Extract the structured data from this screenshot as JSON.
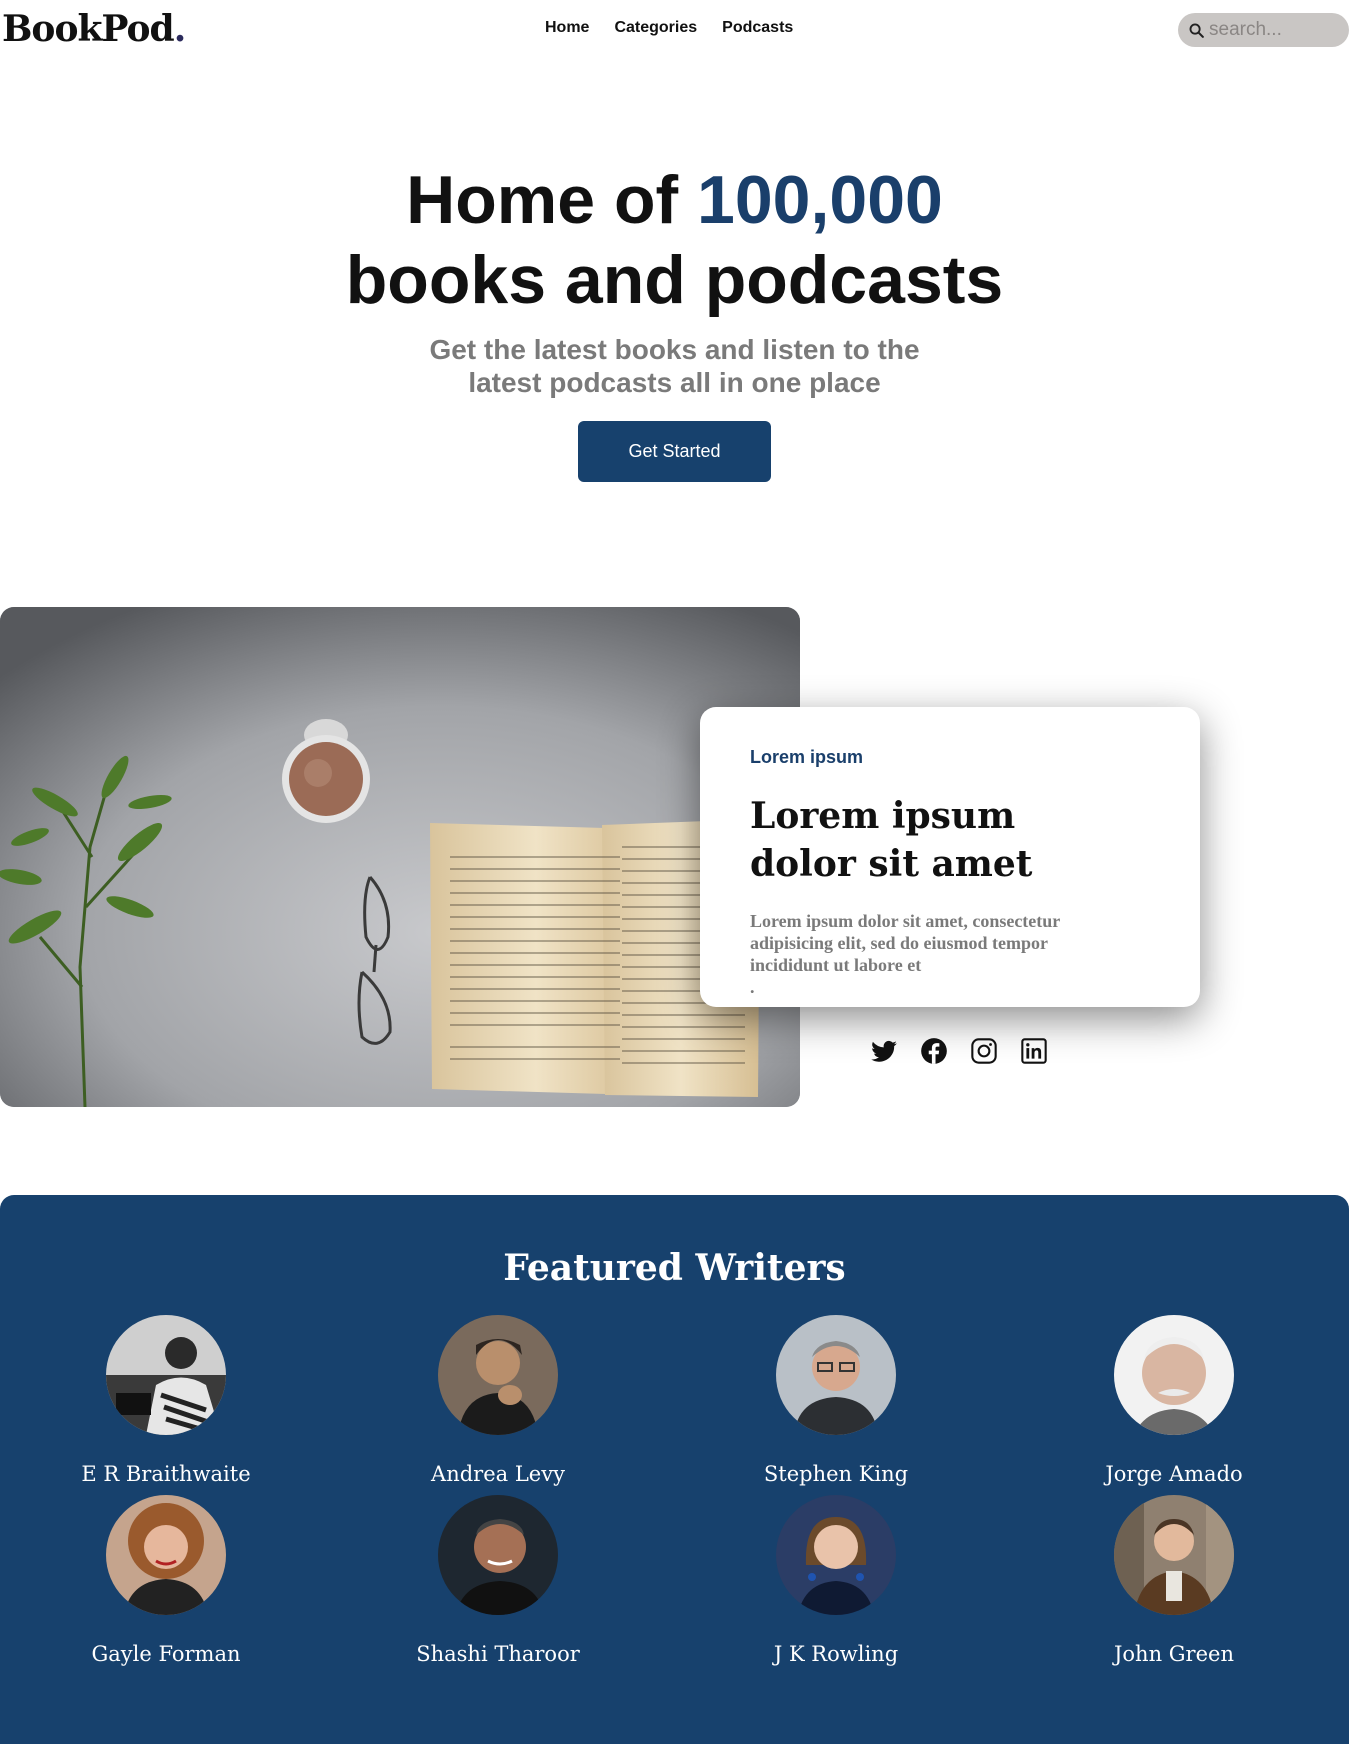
{
  "header": {
    "logo_text": "BookPod",
    "logo_dot": ".",
    "nav": [
      {
        "label": "Home"
      },
      {
        "label": "Categories"
      },
      {
        "label": "Podcasts"
      }
    ],
    "search_placeholder": "search..."
  },
  "hero": {
    "title_prefix": "Home of ",
    "title_accent": "100,000",
    "title_suffix": "books and podcasts",
    "subtitle_line1": "Get the latest books and listen to the",
    "subtitle_line2": "latest podcasts all in one place",
    "cta_label": "Get Started"
  },
  "card": {
    "eyebrow": "Lorem ipsum",
    "title": "Lorem ipsum dolor sit amet",
    "body": "Lorem ipsum dolor sit amet, consectetur adipisicing elit, sed do eiusmod tempor incididunt ut labore et",
    "trailing": "."
  },
  "socials": [
    "twitter-icon",
    "facebook-icon",
    "instagram-icon",
    "linkedin-icon"
  ],
  "featured": {
    "title": "Featured Writers",
    "writers": [
      {
        "name": "E R Braithwaite"
      },
      {
        "name": "Andrea Levy"
      },
      {
        "name": "Stephen King"
      },
      {
        "name": "Jorge Amado"
      },
      {
        "name": "Gayle Forman"
      },
      {
        "name": "Shashi Tharoor"
      },
      {
        "name": "J K Rowling"
      },
      {
        "name": "John Green"
      }
    ]
  },
  "colors": {
    "brand_navy": "#17416d",
    "accent": "#1a3f6b",
    "muted_text": "#7a7a7a",
    "search_bg": "#c9c6c4"
  }
}
